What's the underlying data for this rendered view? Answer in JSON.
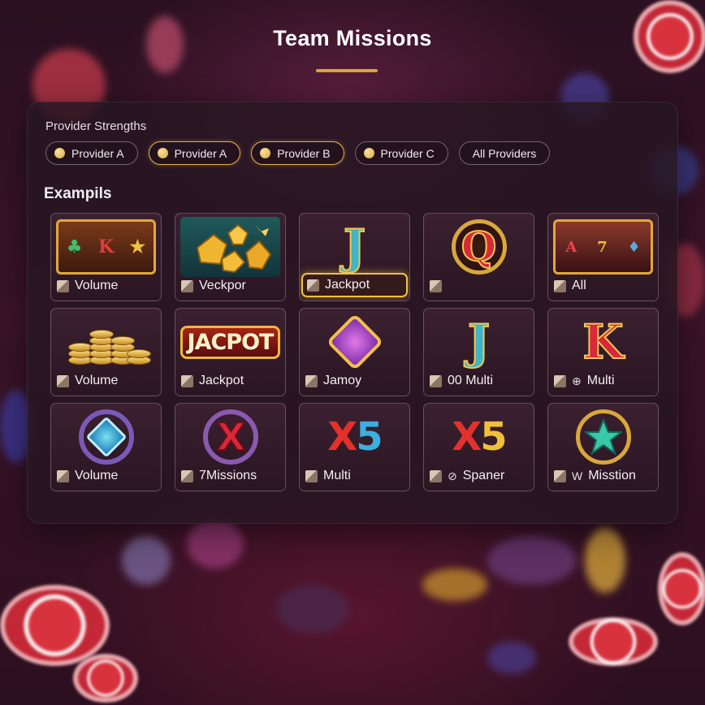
{
  "title": "Team Missions",
  "filters": {
    "label": "Provider Strengths",
    "pills": [
      {
        "label": "Provider A",
        "active": false,
        "dot": true
      },
      {
        "label": "Provider A",
        "active": true,
        "dot": true
      },
      {
        "label": "Provider B",
        "active": true,
        "dot": true
      },
      {
        "label": "Provider C",
        "active": false,
        "dot": true
      },
      {
        "label": "All Providers",
        "active": false,
        "dot": false
      }
    ]
  },
  "examples_heading": "Exampils",
  "tiles": [
    {
      "label": "Volume",
      "art": "slot-reels-icon"
    },
    {
      "label": "Veckpor",
      "art": "gold-gems-icon"
    },
    {
      "label": "Jackpot",
      "art": "letter-j-icon",
      "highlighted": true
    },
    {
      "label": "",
      "art": "letter-q-icon"
    },
    {
      "label": "All",
      "art": "slot-machine-icon"
    },
    {
      "label": "Volume",
      "art": "coin-stacks-icon"
    },
    {
      "label": "Jackpot",
      "art": "jackpot-sign-icon"
    },
    {
      "label": "Jamoy",
      "art": "purple-gem-icon"
    },
    {
      "label": "00 Multi",
      "art": "letter-j-icon"
    },
    {
      "label": "Multi",
      "art": "letter-k-icon",
      "badge": "⊕"
    },
    {
      "label": "Volume",
      "art": "blue-gem-ring-icon"
    },
    {
      "label": "7Missions",
      "art": "red-x-ring-icon"
    },
    {
      "label": "Multi",
      "art": "x5-multiplier-icon"
    },
    {
      "label": "Spaner",
      "art": "x5-multiplier-icon",
      "badge": "⊘"
    },
    {
      "label": "Misstion",
      "art": "star-ring-icon",
      "badge": "W"
    }
  ]
}
